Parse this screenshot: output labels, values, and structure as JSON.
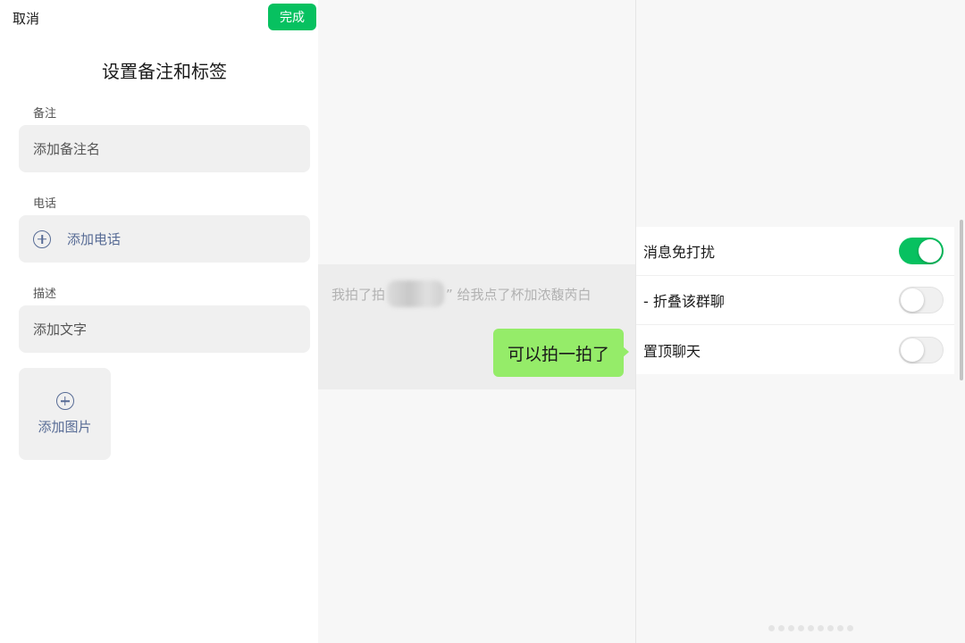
{
  "header": {
    "cancel_label": "取消",
    "done_label": "完成",
    "title": "设置备注和标签"
  },
  "form": {
    "remark": {
      "label": "备注",
      "placeholder": "添加备注名"
    },
    "phone": {
      "label": "电话",
      "add_label": "添加电话"
    },
    "description": {
      "label": "描述",
      "placeholder": "添加文字"
    },
    "image": {
      "add_label": "添加图片"
    }
  },
  "chat": {
    "system_message": {
      "prefix": "我拍了拍",
      "suffix": "” 给我点了杯加浓馥芮白"
    },
    "my_message": "可以拍一拍了"
  },
  "settings": {
    "items": [
      {
        "label": "消息免打扰",
        "enabled": true
      },
      {
        "label": "- 折叠该群聊",
        "enabled": false
      },
      {
        "label": "置顶聊天",
        "enabled": false
      }
    ]
  },
  "colors": {
    "accent": "#07c160",
    "bubble": "#95ec69",
    "link": "#576b95"
  },
  "icons": [
    "plus-circle-icon",
    "toggle-switch"
  ]
}
